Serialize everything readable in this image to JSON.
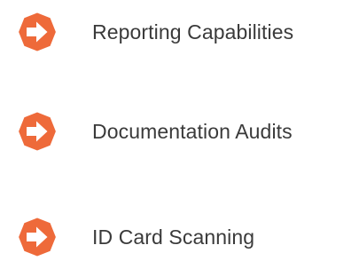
{
  "colors": {
    "accent": "#ee6a3a",
    "arrow": "#ffffff",
    "text": "#3a3a3a"
  },
  "items": [
    {
      "icon": "right-arrow-circle-icon",
      "label": "Reporting Capabilities"
    },
    {
      "icon": "right-arrow-circle-icon",
      "label": "Documentation Audits"
    },
    {
      "icon": "right-arrow-circle-icon",
      "label": "ID Card Scanning"
    }
  ]
}
